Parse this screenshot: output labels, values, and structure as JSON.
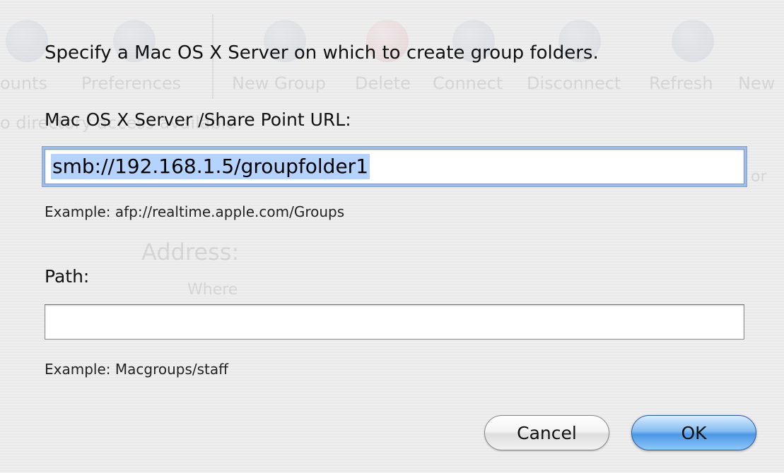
{
  "background": {
    "toolbar_items": [
      "ounts",
      "Preferences",
      "New Group",
      "Delete",
      "Connect",
      "Disconnect",
      "Refresh",
      "New"
    ],
    "directory_text": "o directory access available",
    "address_label": "Address:",
    "where_label": "Where",
    "or_text": "or"
  },
  "dialog": {
    "prompt": "Specify a Mac OS X Server on which to create group folders.",
    "url_label": "Mac OS X Server /Share Point URL:",
    "url_value": "smb://192.168.1.5/groupfolder1",
    "url_example": "Example: afp://realtime.apple.com/Groups",
    "path_label": "Path:",
    "path_value": "",
    "path_example": "Example: Macgroups/staff",
    "cancel_label": "Cancel",
    "ok_label": "OK"
  },
  "colors": {
    "selection_highlight": "#b5d3ff",
    "default_button": "#4c96e4",
    "focus_ring": "#9fbde6"
  }
}
